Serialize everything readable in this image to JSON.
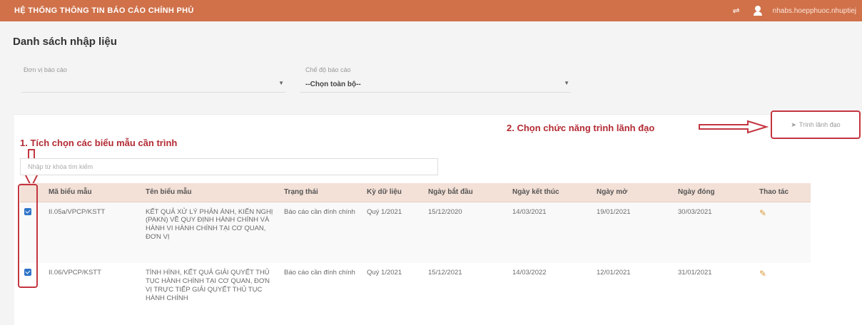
{
  "app": {
    "title": "HỆ THỐNG THÔNG TIN BÁO CÁO CHÍNH PHỦ",
    "username": "nhabs.hoepphuoc.nhuptiej"
  },
  "page": {
    "title": "Danh sách nhập liệu"
  },
  "filters": {
    "donvi_label": "Đơn vị báo cáo",
    "donvi_value": "",
    "chedo_label": "Chế độ báo cáo",
    "chedo_value": "--Chọn toàn bộ--"
  },
  "annotations": {
    "step1": "1. Tích chọn các biểu mẫu cần trình",
    "step2": "2. Chọn chức năng trình lãnh đạo"
  },
  "toolbar": {
    "trinh_label": "Trình lãnh đạo"
  },
  "search": {
    "placeholder": "Nhập từ khóa tìm kiếm"
  },
  "table": {
    "headers": [
      "Mã biểu mẫu",
      "Tên biểu mẫu",
      "Trạng thái",
      "Kỳ dữ liệu",
      "Ngày bắt đầu",
      "Ngày kết thúc",
      "Ngày mở",
      "Ngày đóng",
      "Thao tác"
    ],
    "rows": [
      {
        "checked": true,
        "ma": "II.05a/VPCP/KSTT",
        "ten": "KẾT QUẢ XỬ LÝ PHẢN ÁNH, KIẾN NGHỊ (PAKN) VỀ QUY ĐỊNH HÀNH CHÍNH VÀ HÀNH VI HÀNH CHÍNH TẠI CƠ QUAN, ĐƠN VỊ",
        "trangthai": "Báo cáo cần đính chính",
        "ky": "Quý 1/2021",
        "batdau": "15/12/2020",
        "ketthuc": "14/03/2021",
        "mo": "19/01/2021",
        "dong": "30/03/2021"
      },
      {
        "checked": true,
        "ma": "II.06/VPCP/KSTT",
        "ten": "TÌNH HÌNH, KẾT QUẢ GIẢI QUYẾT THỦ TỤC HÀNH CHÍNH TẠI CƠ QUAN, ĐƠN VỊ TRỰC TIẾP GIẢI QUYẾT THỦ TỤC HÀNH CHÍNH",
        "trangthai": "Báo cáo cần đính chính",
        "ky": "Quý 1/2021",
        "batdau": "15/12/2021",
        "ketthuc": "14/03/2022",
        "mo": "12/01/2021",
        "dong": "31/01/2021"
      }
    ]
  },
  "colors": {
    "topbar": "#d0714a",
    "accent_red": "#c43540",
    "checkbox": "#2f74c8"
  },
  "icons": {
    "notify": "bell-icon",
    "user": "user-icon",
    "edit": "pencil-icon",
    "send": "send-icon"
  }
}
